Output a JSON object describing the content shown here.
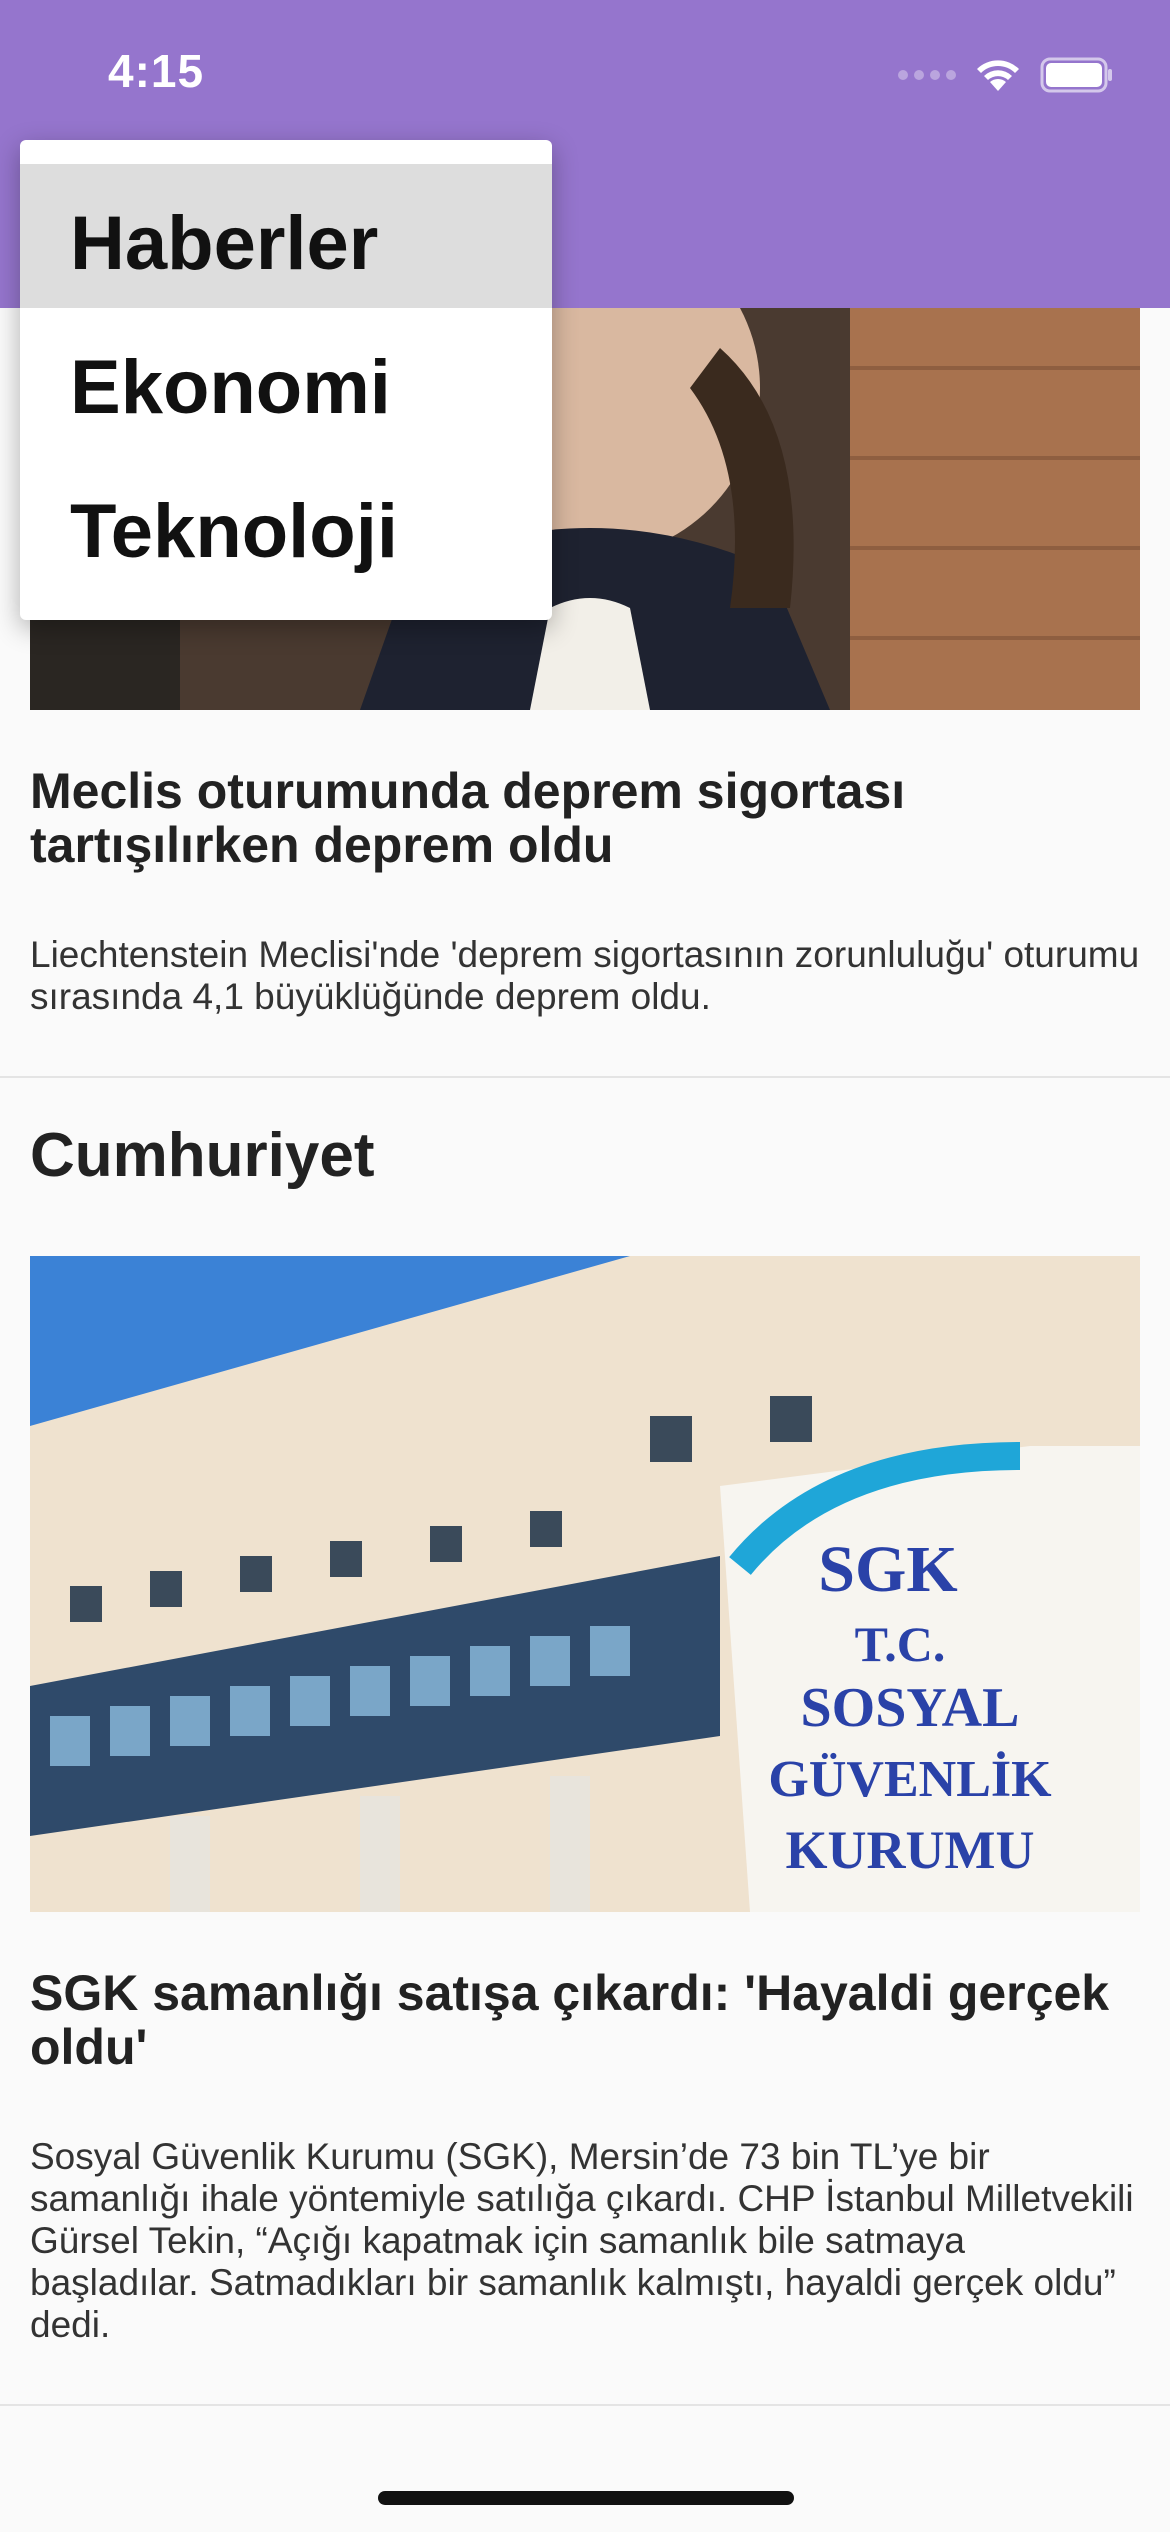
{
  "status_bar": {
    "time": "4:15"
  },
  "menu": {
    "items": [
      {
        "label": "Haberler",
        "selected": true
      },
      {
        "label": "Ekonomi",
        "selected": false
      },
      {
        "label": "Teknoloji",
        "selected": false
      }
    ]
  },
  "articles": [
    {
      "title": "Meclis oturumunda deprem sigortası tartışılırken deprem oldu",
      "description": "Liechtenstein Meclisi'nde 'deprem sigortasının zorunluluğu' oturumu sırasında 4,1 büyüklüğünde deprem oldu."
    }
  ],
  "sections": [
    {
      "name": "Cumhuriyet",
      "articles": [
        {
          "title": "SGK samanlığı satışa çıkardı: 'Hayaldi gerçek oldu'",
          "description": "Sosyal Güvenlik Kurumu (SGK), Mersin’de 73 bin TL’ye bir samanlığı ihale yöntemiyle satılığa çıkardı. CHP İstanbul Milletvekili Gürsel Tekin, “Açığı kapatmak için samanlık bile satmaya başladılar. Satmadıkları bir samanlık kalmıştı, hayaldi gerçek oldu” dedi.",
          "image_sign": [
            "SGK",
            "T.C.",
            "SOSYAL",
            "GÜVENLİK",
            "KURUMU"
          ]
        }
      ]
    }
  ]
}
